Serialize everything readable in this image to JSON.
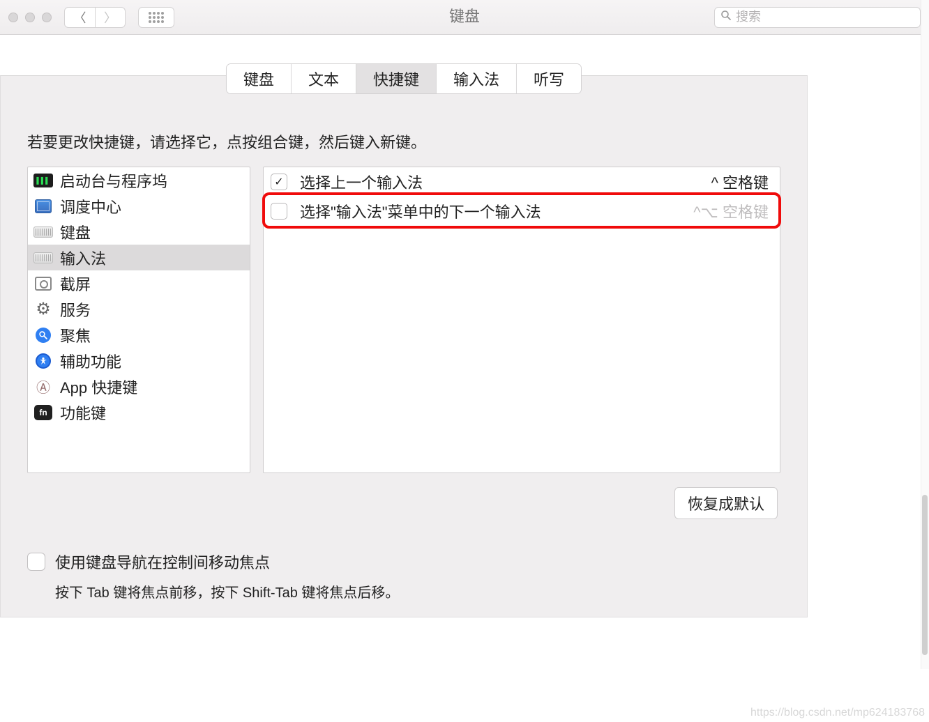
{
  "toolbar": {
    "title": "键盘",
    "search_placeholder": "搜索"
  },
  "tabs": [
    {
      "label": "键盘",
      "active": false
    },
    {
      "label": "文本",
      "active": false
    },
    {
      "label": "快捷键",
      "active": true
    },
    {
      "label": "输入法",
      "active": false
    },
    {
      "label": "听写",
      "active": false
    }
  ],
  "instruction": "若要更改快捷键，请选择它，点按组合键，然后键入新键。",
  "categories": [
    {
      "label": "启动台与程序坞",
      "icon": "terminal-icon"
    },
    {
      "label": "调度中心",
      "icon": "mission-control-icon"
    },
    {
      "label": "键盘",
      "icon": "keyboard-flat-icon"
    },
    {
      "label": "输入法",
      "icon": "keyboard-flat-icon",
      "selected": true
    },
    {
      "label": "截屏",
      "icon": "screenshot-icon"
    },
    {
      "label": "服务",
      "icon": "gear-icon"
    },
    {
      "label": "聚焦",
      "icon": "spotlight-icon"
    },
    {
      "label": "辅助功能",
      "icon": "accessibility-icon"
    },
    {
      "label": "App 快捷键",
      "icon": "app-icon"
    },
    {
      "label": "功能键",
      "icon": "fn-icon"
    }
  ],
  "shortcuts": [
    {
      "checked": true,
      "label": "选择上一个输入法",
      "shortcut": "^ 空格键",
      "dim": false,
      "highlight": false
    },
    {
      "checked": false,
      "label": "选择\"输入法\"菜单中的下一个输入法",
      "shortcut": "^⌥ 空格键",
      "dim": true,
      "highlight": true
    }
  ],
  "restore_button": "恢复成默认",
  "keyboard_nav": {
    "checkbox_label": "使用键盘导航在控制间移动焦点",
    "help": "按下 Tab 键将焦点前移，按下 Shift-Tab 键将焦点后移。"
  },
  "watermark": "https://blog.csdn.net/mp624183768"
}
